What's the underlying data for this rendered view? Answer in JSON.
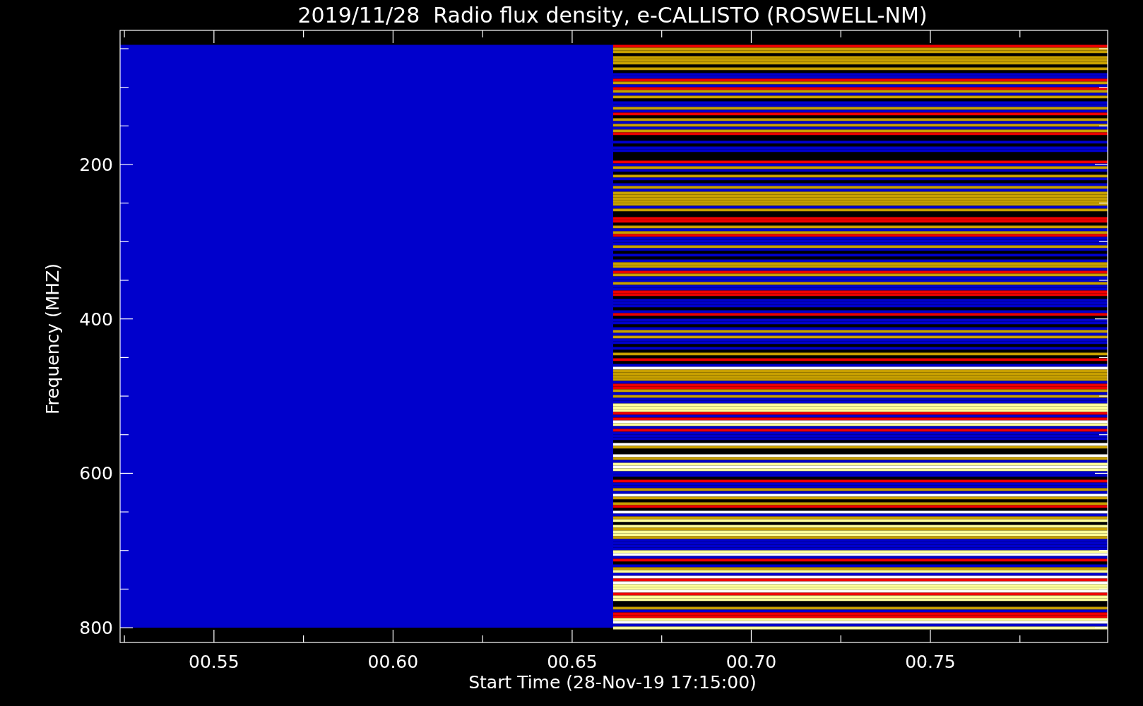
{
  "plot": {
    "title": "2019/11/28  Radio flux density, e-CALLISTO (ROSWELL-NM)",
    "xlabel": "Start Time (28-Nov-19 17:15:00)",
    "ylabel": "Frequency (MHZ)",
    "xticks": [
      "00.55",
      "00.60",
      "00.65",
      "00.70",
      "00.75"
    ],
    "yticks": [
      "200",
      "400",
      "600",
      "800"
    ]
  }
}
